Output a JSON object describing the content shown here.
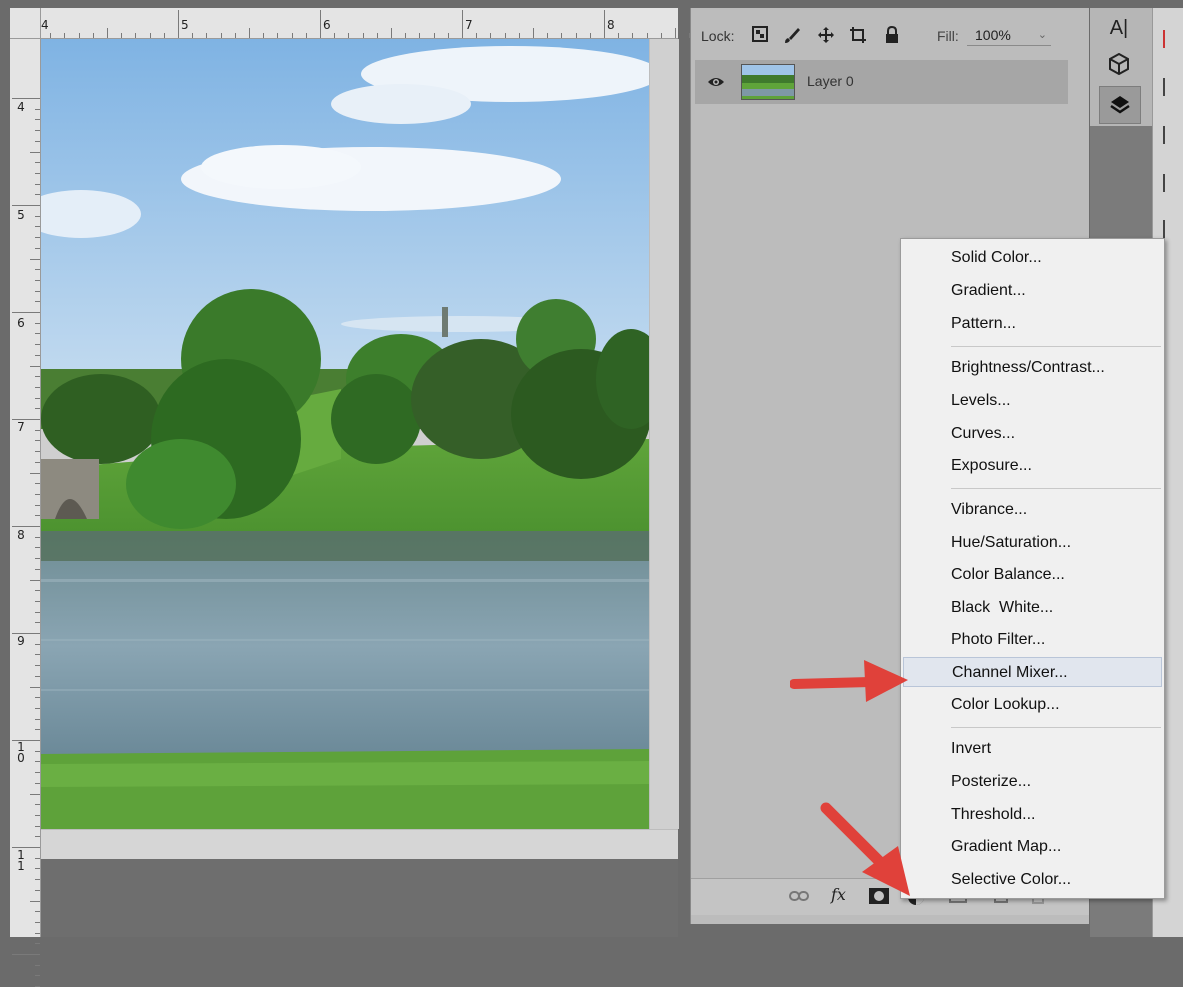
{
  "ruler_top": {
    "labels": [
      "4",
      "5",
      "6",
      "7",
      "8"
    ]
  },
  "ruler_left": {
    "labels": [
      "4",
      "5",
      "6",
      "7",
      "8",
      "9",
      "1\n0",
      "1\n1"
    ]
  },
  "layers_panel": {
    "lock_label": "Lock:",
    "lock_icons": [
      "lock-transparent-pixels-icon",
      "lock-image-pixels-icon",
      "lock-position-icon",
      "lock-artboard-icon",
      "lock-all-icon"
    ],
    "fill_label": "Fill:",
    "fill_value": "100%",
    "layer": {
      "name": "Layer 0",
      "visible": true
    },
    "footer_icons": [
      "link-layers-icon",
      "fx-icon",
      "layer-mask-icon",
      "adjustment-layer-icon",
      "group-icon",
      "new-layer-icon",
      "delete-layer-icon"
    ],
    "fx_text": "fx"
  },
  "tool_strip": {
    "icons": [
      "character-icon",
      "3d-icon",
      "layers-icon"
    ],
    "character_text": "A|"
  },
  "adjustment_menu": {
    "groups": [
      [
        "Solid Color...",
        "Gradient...",
        "Pattern..."
      ],
      [
        "Brightness/Contrast...",
        "Levels...",
        "Curves...",
        "Exposure..."
      ],
      [
        "Vibrance...",
        "Hue/Saturation...",
        "Color Balance...",
        "Black  White...",
        "Photo Filter...",
        "Channel Mixer...",
        "Color Lookup..."
      ],
      [
        "Invert",
        "Posterize...",
        "Threshold...",
        "Gradient Map...",
        "Selective Color..."
      ]
    ],
    "highlighted": "Channel Mixer..."
  },
  "colors": {
    "panel_bg": "#bcbcbc",
    "menu_bg": "#f0f0f0",
    "highlight": "#e1e6ee",
    "arrow": "#e0413a"
  }
}
